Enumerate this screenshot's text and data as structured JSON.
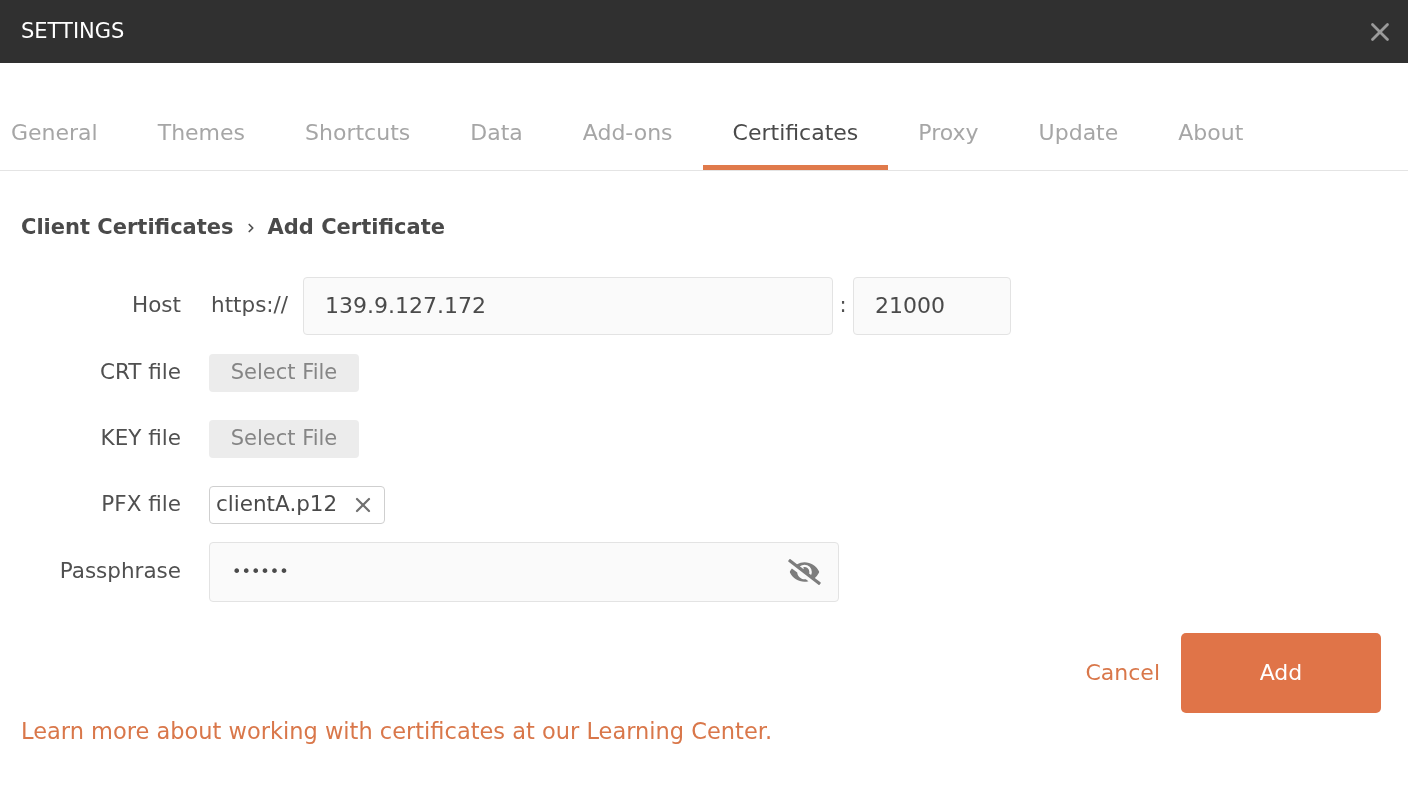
{
  "window": {
    "title": "SETTINGS"
  },
  "tabs": [
    {
      "label": "General",
      "selected": false
    },
    {
      "label": "Themes",
      "selected": false
    },
    {
      "label": "Shortcuts",
      "selected": false
    },
    {
      "label": "Data",
      "selected": false
    },
    {
      "label": "Add-ons",
      "selected": false
    },
    {
      "label": "Certificates",
      "selected": true
    },
    {
      "label": "Proxy",
      "selected": false
    },
    {
      "label": "Update",
      "selected": false
    },
    {
      "label": "About",
      "selected": false
    }
  ],
  "breadcrumb": [
    "Client Certificates",
    "Add Certificate"
  ],
  "form": [
    {
      "kind": "host",
      "label": "Host",
      "prefix": "https://",
      "value": "139.9.127.172",
      "separator": ":",
      "port": "21000"
    },
    {
      "kind": "file",
      "label": "CRT file",
      "button": "Select File"
    },
    {
      "kind": "file",
      "label": "KEY file",
      "button": "Select File"
    },
    {
      "kind": "chip",
      "label": "PFX file",
      "file_name": "clientA.p12"
    },
    {
      "kind": "password",
      "label": "Passphrase",
      "value": "••••••"
    }
  ],
  "actions": {
    "cancel": "Cancel",
    "submit": "Add"
  },
  "footer_link": "Learn more about working with certificates at our Learning Center."
}
